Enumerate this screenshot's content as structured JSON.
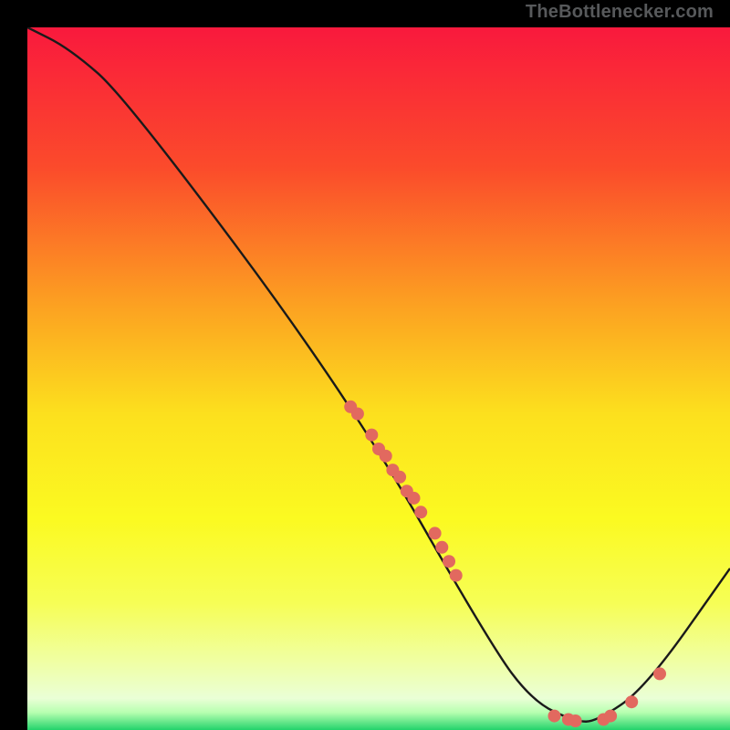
{
  "watermark": "TheBottlenecker.com",
  "chart_data": {
    "type": "line",
    "title": "",
    "xlabel": "",
    "ylabel": "",
    "xlim": [
      0,
      100
    ],
    "ylim": [
      0,
      100
    ],
    "curve": [
      {
        "x": 0,
        "y": 100
      },
      {
        "x": 6,
        "y": 97
      },
      {
        "x": 14,
        "y": 90
      },
      {
        "x": 46,
        "y": 47
      },
      {
        "x": 66,
        "y": 12
      },
      {
        "x": 72,
        "y": 4
      },
      {
        "x": 78,
        "y": 1.2
      },
      {
        "x": 81,
        "y": 1.2
      },
      {
        "x": 88,
        "y": 6
      },
      {
        "x": 100,
        "y": 23
      }
    ],
    "scatter": [
      {
        "x": 46,
        "y": 46
      },
      {
        "x": 47,
        "y": 45
      },
      {
        "x": 49,
        "y": 42
      },
      {
        "x": 50,
        "y": 40
      },
      {
        "x": 51,
        "y": 39
      },
      {
        "x": 52,
        "y": 37
      },
      {
        "x": 53,
        "y": 36
      },
      {
        "x": 54,
        "y": 34
      },
      {
        "x": 55,
        "y": 33
      },
      {
        "x": 56,
        "y": 31
      },
      {
        "x": 58,
        "y": 28
      },
      {
        "x": 59,
        "y": 26
      },
      {
        "x": 60,
        "y": 24
      },
      {
        "x": 61,
        "y": 22
      },
      {
        "x": 75,
        "y": 2
      },
      {
        "x": 77,
        "y": 1.5
      },
      {
        "x": 78,
        "y": 1.3
      },
      {
        "x": 82,
        "y": 1.5
      },
      {
        "x": 83,
        "y": 2
      },
      {
        "x": 86,
        "y": 4
      },
      {
        "x": 90,
        "y": 8
      }
    ],
    "gradient_stops": [
      {
        "offset": 0.0,
        "color": "#f9193d"
      },
      {
        "offset": 0.2,
        "color": "#fb4b2b"
      },
      {
        "offset": 0.4,
        "color": "#fca321"
      },
      {
        "offset": 0.55,
        "color": "#fce01e"
      },
      {
        "offset": 0.7,
        "color": "#fbfa21"
      },
      {
        "offset": 0.82,
        "color": "#f6fe56"
      },
      {
        "offset": 0.9,
        "color": "#f0ffa1"
      },
      {
        "offset": 0.955,
        "color": "#eaffd6"
      },
      {
        "offset": 0.975,
        "color": "#b7ffb0"
      },
      {
        "offset": 1.0,
        "color": "#23d36b"
      }
    ],
    "scatter_color": "#e2695f",
    "curve_color": "#1a1a1a"
  }
}
